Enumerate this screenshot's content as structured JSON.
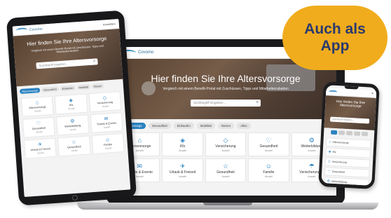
{
  "brand": {
    "name": "Covomo"
  },
  "header": {
    "login_label": "Anmelden"
  },
  "hero": {
    "title": "Hier finden Sie Ihre Altersvorsorge",
    "subtitle": "Vergleich mit einem Benefit-Portal mit Zuschüssen, Tipps und Mitarbeiterrabatten",
    "search_placeholder": "Suchbegriff eingeben...",
    "search_icon": "search-icon"
  },
  "categories": [
    {
      "label": "Altersvorsorge",
      "active": true
    },
    {
      "label": "Gesundheit"
    },
    {
      "label": "Einkaufen"
    },
    {
      "label": "Mobilität"
    },
    {
      "label": "Reisen"
    },
    {
      "label": "Alles"
    }
  ],
  "tiles": [
    {
      "icon": "home-icon",
      "label": "Altersvorsorge",
      "count": "Anzahl"
    },
    {
      "icon": "car-icon",
      "label": "Kfz",
      "count": "Anzahl"
    },
    {
      "icon": "shield-icon",
      "label": "Versicherung",
      "count": "Anzahl"
    },
    {
      "icon": "heart-icon",
      "label": "Gesundheit",
      "count": "Anzahl"
    },
    {
      "icon": "gear-icon",
      "label": "Weiterbildung",
      "count": "Anzahl"
    },
    {
      "icon": "ticket-icon",
      "label": "Tickets & Events",
      "count": "Anzahl"
    },
    {
      "icon": "plane-icon",
      "label": "Urlaub & Freizeit",
      "count": "Anzahl"
    },
    {
      "icon": "star-icon",
      "label": "Gesundheit",
      "count": "Anzahl"
    },
    {
      "icon": "family-icon",
      "label": "Familie",
      "count": "Anzahl"
    },
    {
      "icon": "umbrella-icon",
      "label": "Versicherungen",
      "count": "Anzahl"
    }
  ],
  "badge": {
    "line1": "Auch als",
    "line2": "App"
  },
  "colors": {
    "accent": "#2b82c1",
    "badge": "#f0ac1c",
    "badge_text": "#2b3a6e"
  }
}
